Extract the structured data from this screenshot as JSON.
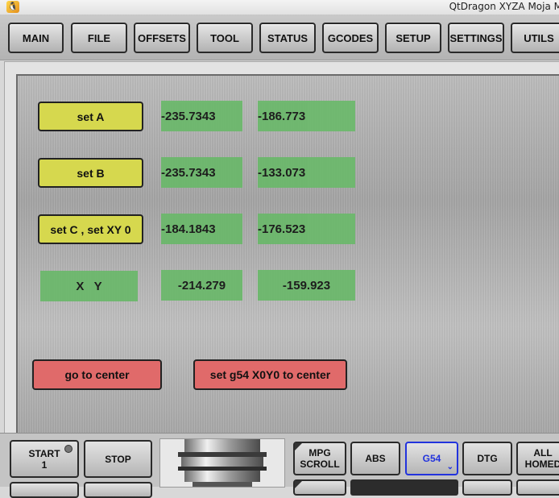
{
  "window": {
    "title": "QtDragon XYZA Moja M"
  },
  "tabs": [
    "MAIN",
    "FILE",
    "OFFSETS",
    "TOOL",
    "STATUS",
    "GCODES",
    "SETUP",
    "SETTINGS",
    "UTILS"
  ],
  "rows": {
    "a": {
      "label": "set A",
      "x": "-235.7343",
      "y": "-186.773"
    },
    "b": {
      "label": "set B",
      "x": "-235.7343",
      "y": "-133.073"
    },
    "c": {
      "label": "set C , set XY 0",
      "x": "-184.1843",
      "y": "-176.523"
    },
    "xy": {
      "label": "X   Y",
      "x": "-214.279",
      "y": "-159.923"
    }
  },
  "actions": {
    "go_center": "go to center",
    "set_g54": "set g54 X0Y0 to center"
  },
  "bottom": {
    "start": "START\n1",
    "stop": "STOP",
    "mpg": "MPG\nSCROLL",
    "abs": "ABS",
    "g54": "G54",
    "dtg": "DTG",
    "all_homed": "ALL\nHOMED"
  },
  "colors": {
    "yellow_button": "#d6d84e",
    "red_button": "#e06a6a",
    "value_green": "#6ab86a",
    "active_blue": "#2233dd"
  }
}
